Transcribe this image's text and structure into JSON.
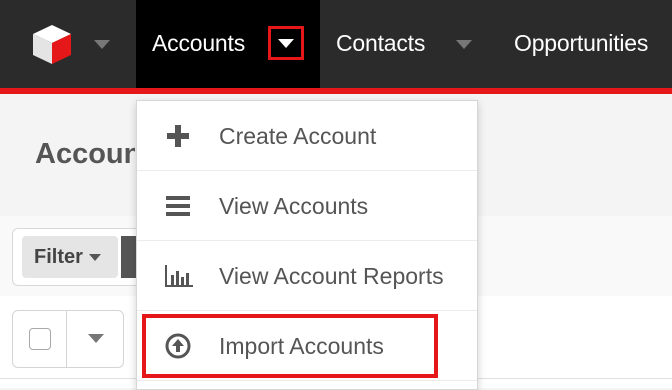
{
  "nav": {
    "items": [
      {
        "label": "Accounts"
      },
      {
        "label": "Contacts"
      },
      {
        "label": "Opportunities"
      }
    ],
    "colors": {
      "bar": "#2b2b2b",
      "active": "#000000",
      "accent": "#e61718"
    }
  },
  "page": {
    "title": "Accounts",
    "filter_label": "Filter"
  },
  "dropdown": {
    "items": [
      {
        "label": "Create Account",
        "icon": "plus-icon"
      },
      {
        "label": "View Accounts",
        "icon": "list-icon"
      },
      {
        "label": "View Account Reports",
        "icon": "bar-chart-icon"
      },
      {
        "label": "Import Accounts",
        "icon": "upload-circle-icon",
        "highlighted": true
      }
    ]
  }
}
